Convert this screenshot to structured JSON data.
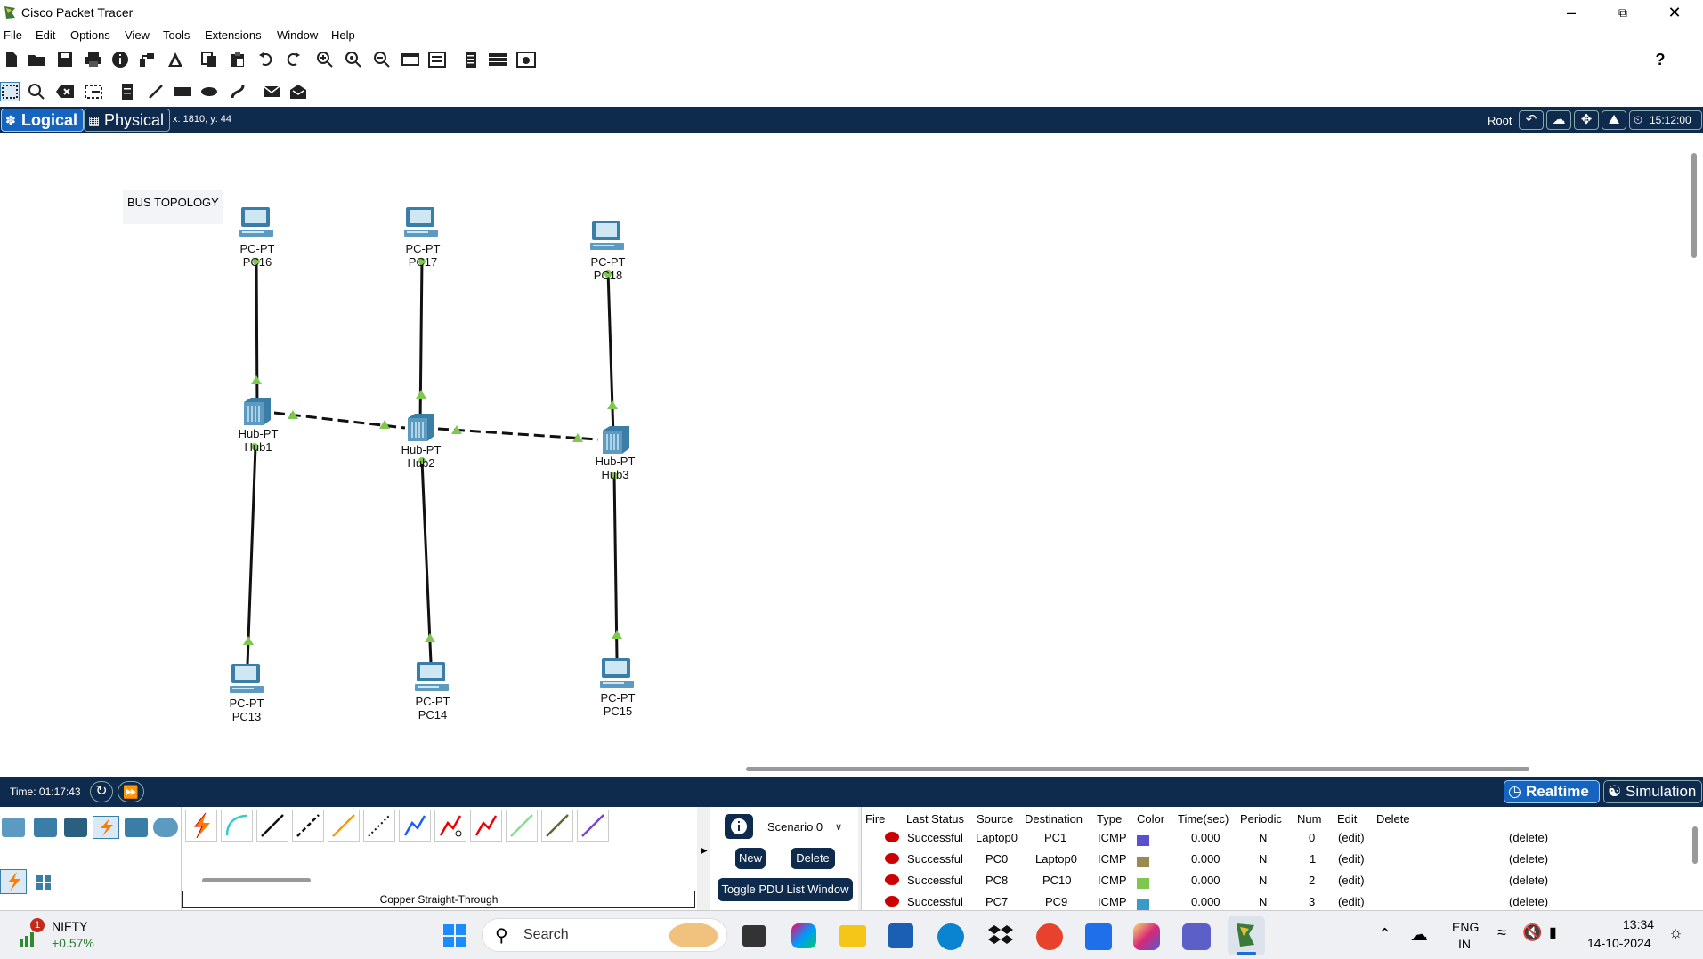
{
  "app": {
    "title": "Cisco Packet Tracer"
  },
  "menu": [
    "File",
    "Edit",
    "Options",
    "View",
    "Tools",
    "Extensions",
    "Window",
    "Help"
  ],
  "workspace": {
    "logical_tab": "Logical",
    "physical_tab": "Physical",
    "coords": "x: 1810, y: 44",
    "root_label": "Root",
    "clock": "15:12:00",
    "note": "BUS TOPOLOGY",
    "devices": [
      {
        "id": "pc16",
        "type": "PC-PT",
        "name": "PC16"
      },
      {
        "id": "pc17",
        "type": "PC-PT",
        "name": "PC17"
      },
      {
        "id": "pc18",
        "type": "PC-PT",
        "name": "PC18"
      },
      {
        "id": "hub1",
        "type": "Hub-PT",
        "name": "Hub1"
      },
      {
        "id": "hub2",
        "type": "Hub-PT",
        "name": "Hub2"
      },
      {
        "id": "hub3",
        "type": "Hub-PT",
        "name": "Hub3"
      },
      {
        "id": "pc13",
        "type": "PC-PT",
        "name": "PC13"
      },
      {
        "id": "pc14",
        "type": "PC-PT",
        "name": "PC14"
      },
      {
        "id": "pc15",
        "type": "PC-PT",
        "name": "PC15"
      }
    ]
  },
  "timebar": {
    "time": "Time: 01:17:43",
    "realtime": "Realtime",
    "simulation": "Simulation"
  },
  "device_panel": {
    "cable_label": "Copper Straight-Through"
  },
  "scenario": {
    "selected": "Scenario 0",
    "new": "New",
    "delete": "Delete",
    "toggle": "Toggle PDU List Window"
  },
  "pdu_table": {
    "headers": [
      "Fire",
      "Last Status",
      "Source",
      "Destination",
      "Type",
      "Color",
      "Time(sec)",
      "Periodic",
      "Num",
      "Edit",
      "Delete"
    ],
    "rows": [
      {
        "status": "Successful",
        "source": "Laptop0",
        "destination": "PC1",
        "type": "ICMP",
        "color": "#5a4fcf",
        "time": "0.000",
        "periodic": "N",
        "num": "0",
        "edit": "(edit)",
        "delete": "(delete)"
      },
      {
        "status": "Successful",
        "source": "PC0",
        "destination": "Laptop0",
        "type": "ICMP",
        "color": "#9a8a52",
        "time": "0.000",
        "periodic": "N",
        "num": "1",
        "edit": "(edit)",
        "delete": "(delete)"
      },
      {
        "status": "Successful",
        "source": "PC8",
        "destination": "PC10",
        "type": "ICMP",
        "color": "#7ec850",
        "time": "0.000",
        "periodic": "N",
        "num": "2",
        "edit": "(edit)",
        "delete": "(delete)"
      },
      {
        "status": "Successful",
        "source": "PC7",
        "destination": "PC9",
        "type": "ICMP",
        "color": "#3a9ac8",
        "time": "0.000",
        "periodic": "N",
        "num": "3",
        "edit": "(edit)",
        "delete": "(delete)"
      }
    ]
  },
  "taskbar": {
    "stock_name": "NIFTY",
    "stock_change": "+0.57%",
    "stock_badge": "1",
    "search": "Search",
    "lang1": "ENG",
    "lang2": "IN",
    "time": "13:34",
    "date": "14-10-2024"
  },
  "colors": {
    "navy": "#0e2a4c",
    "link_green": "#7ec850",
    "device_blue": "#3a7ea8"
  }
}
